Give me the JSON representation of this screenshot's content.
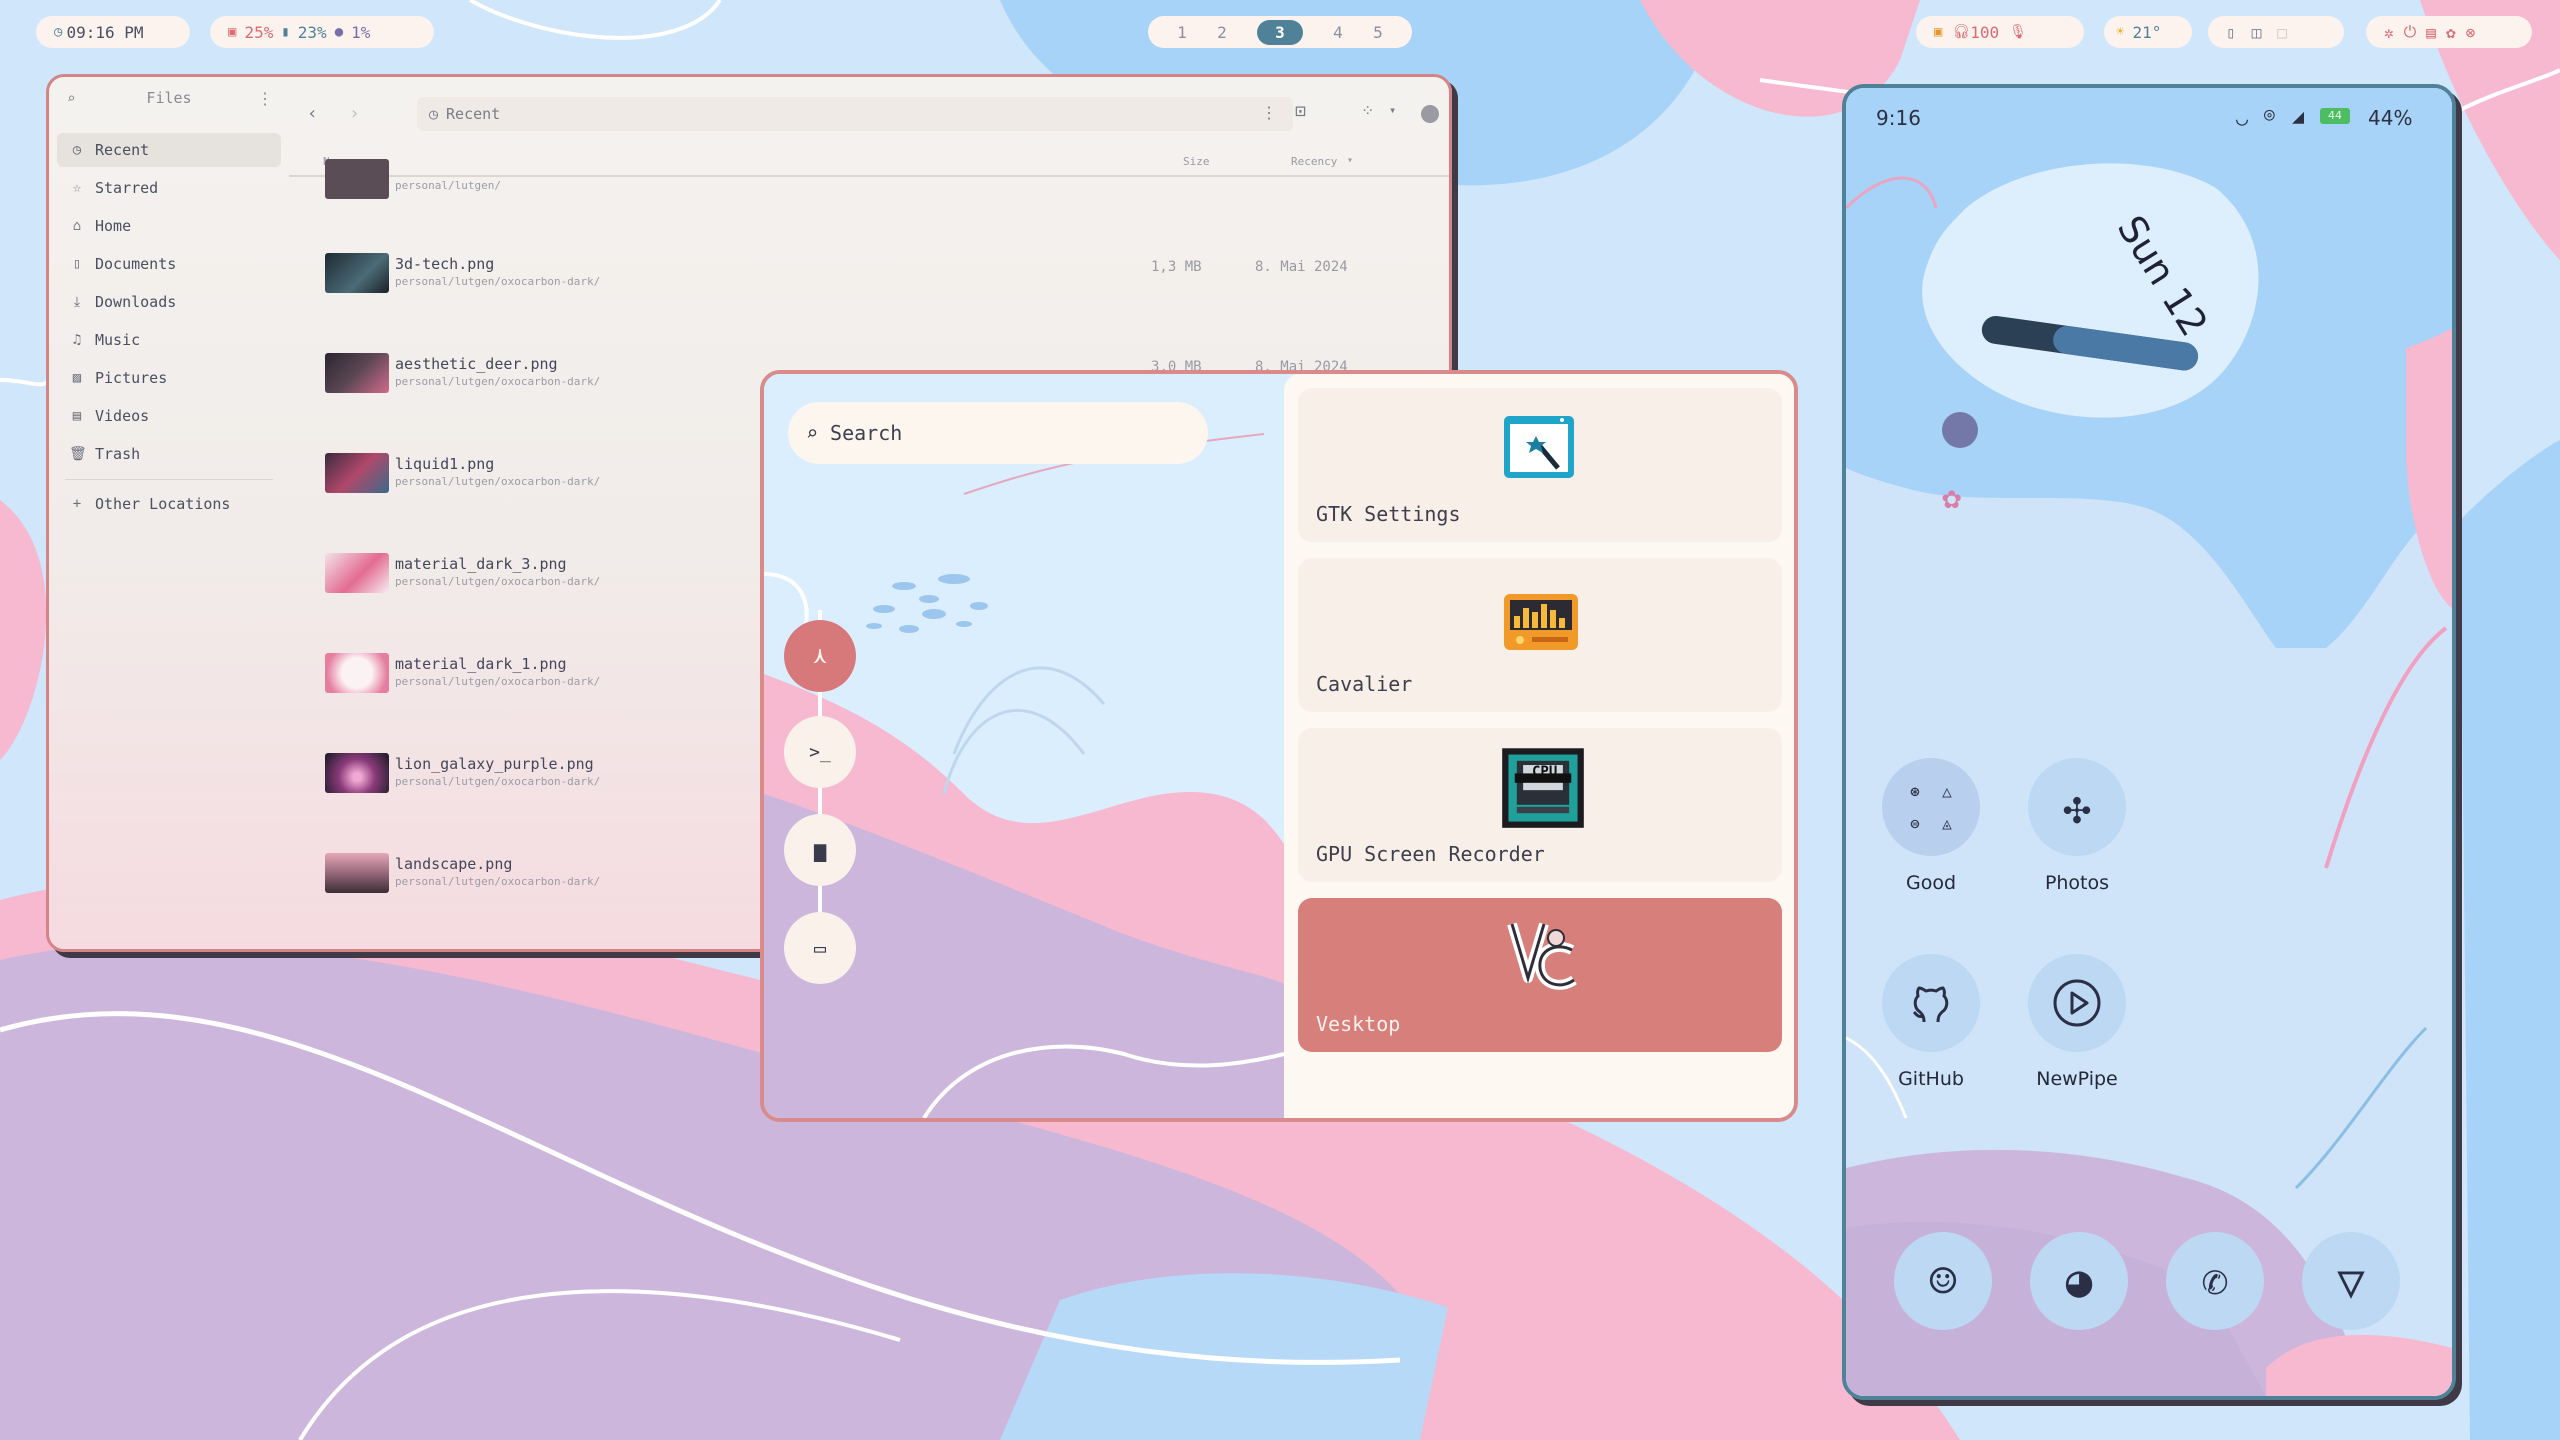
{
  "topbar": {
    "clock": "09:16 PM",
    "cpu": "25%",
    "ram": "23%",
    "disk": "1%",
    "workspaces": [
      "1",
      "2",
      "3",
      "4",
      "5"
    ],
    "active_workspace": "3",
    "volume": "100",
    "weather": "21°"
  },
  "files": {
    "title": "Files",
    "path": "Recent",
    "sidebar": [
      {
        "label": "Recent",
        "icon": "clock-icon"
      },
      {
        "label": "Starred",
        "icon": "star-icon"
      },
      {
        "label": "Home",
        "icon": "home-icon"
      },
      {
        "label": "Documents",
        "icon": "document-icon"
      },
      {
        "label": "Downloads",
        "icon": "download-icon"
      },
      {
        "label": "Music",
        "icon": "music-icon"
      },
      {
        "label": "Pictures",
        "icon": "picture-icon"
      },
      {
        "label": "Videos",
        "icon": "video-icon"
      },
      {
        "label": "Trash",
        "icon": "trash-icon"
      },
      {
        "label": "Other Locations",
        "icon": "plus-icon"
      }
    ],
    "columns": {
      "name": "Name",
      "size": "Size",
      "recency": "Recency"
    },
    "partial_path": "personal/lutgen/",
    "rows": [
      {
        "name": "3d-tech.png",
        "path": "personal/lutgen/oxocarbon-dark/",
        "size": "1,3 MB",
        "date": "8. Mai 2024"
      },
      {
        "name": "aesthetic_deer.png",
        "path": "personal/lutgen/oxocarbon-dark/",
        "size": "3,0 MB",
        "date": "8. Mai 2024"
      },
      {
        "name": "liquid1.png",
        "path": "personal/lutgen/oxocarbon-dark/",
        "size": "",
        "date": ""
      },
      {
        "name": "material_dark_3.png",
        "path": "personal/lutgen/oxocarbon-dark/",
        "size": "",
        "date": ""
      },
      {
        "name": "material_dark_1.png",
        "path": "personal/lutgen/oxocarbon-dark/",
        "size": "",
        "date": ""
      },
      {
        "name": "lion_galaxy_purple.png",
        "path": "personal/lutgen/oxocarbon-dark/",
        "size": "",
        "date": ""
      },
      {
        "name": "landscape.png",
        "path": "personal/lutgen/oxocarbon-dark/",
        "size": "",
        "date": ""
      }
    ]
  },
  "launcher": {
    "search_placeholder": "Search",
    "apps": [
      {
        "label": "GTK Settings"
      },
      {
        "label": "Cavalier"
      },
      {
        "label": "GPU Screen Recorder",
        "icon_text": "CPU"
      },
      {
        "label": "Vesktop"
      }
    ]
  },
  "phone": {
    "time": "9:16",
    "battery": "44%",
    "battery_icon": "44",
    "date": "Sun 12",
    "apps": [
      {
        "label": "Good"
      },
      {
        "label": "Photos"
      },
      {
        "label": "GitHub"
      },
      {
        "label": "NewPipe"
      }
    ],
    "dock": [
      "reddit-icon",
      "firefox-icon",
      "whatsapp-icon",
      "vanadium-icon"
    ]
  },
  "colors": {
    "accent": "#d77f7a",
    "teal": "#4f8298",
    "pink": "#f6b7cf",
    "purple": "#cdb6dc",
    "sky": "#a7d2f7"
  }
}
